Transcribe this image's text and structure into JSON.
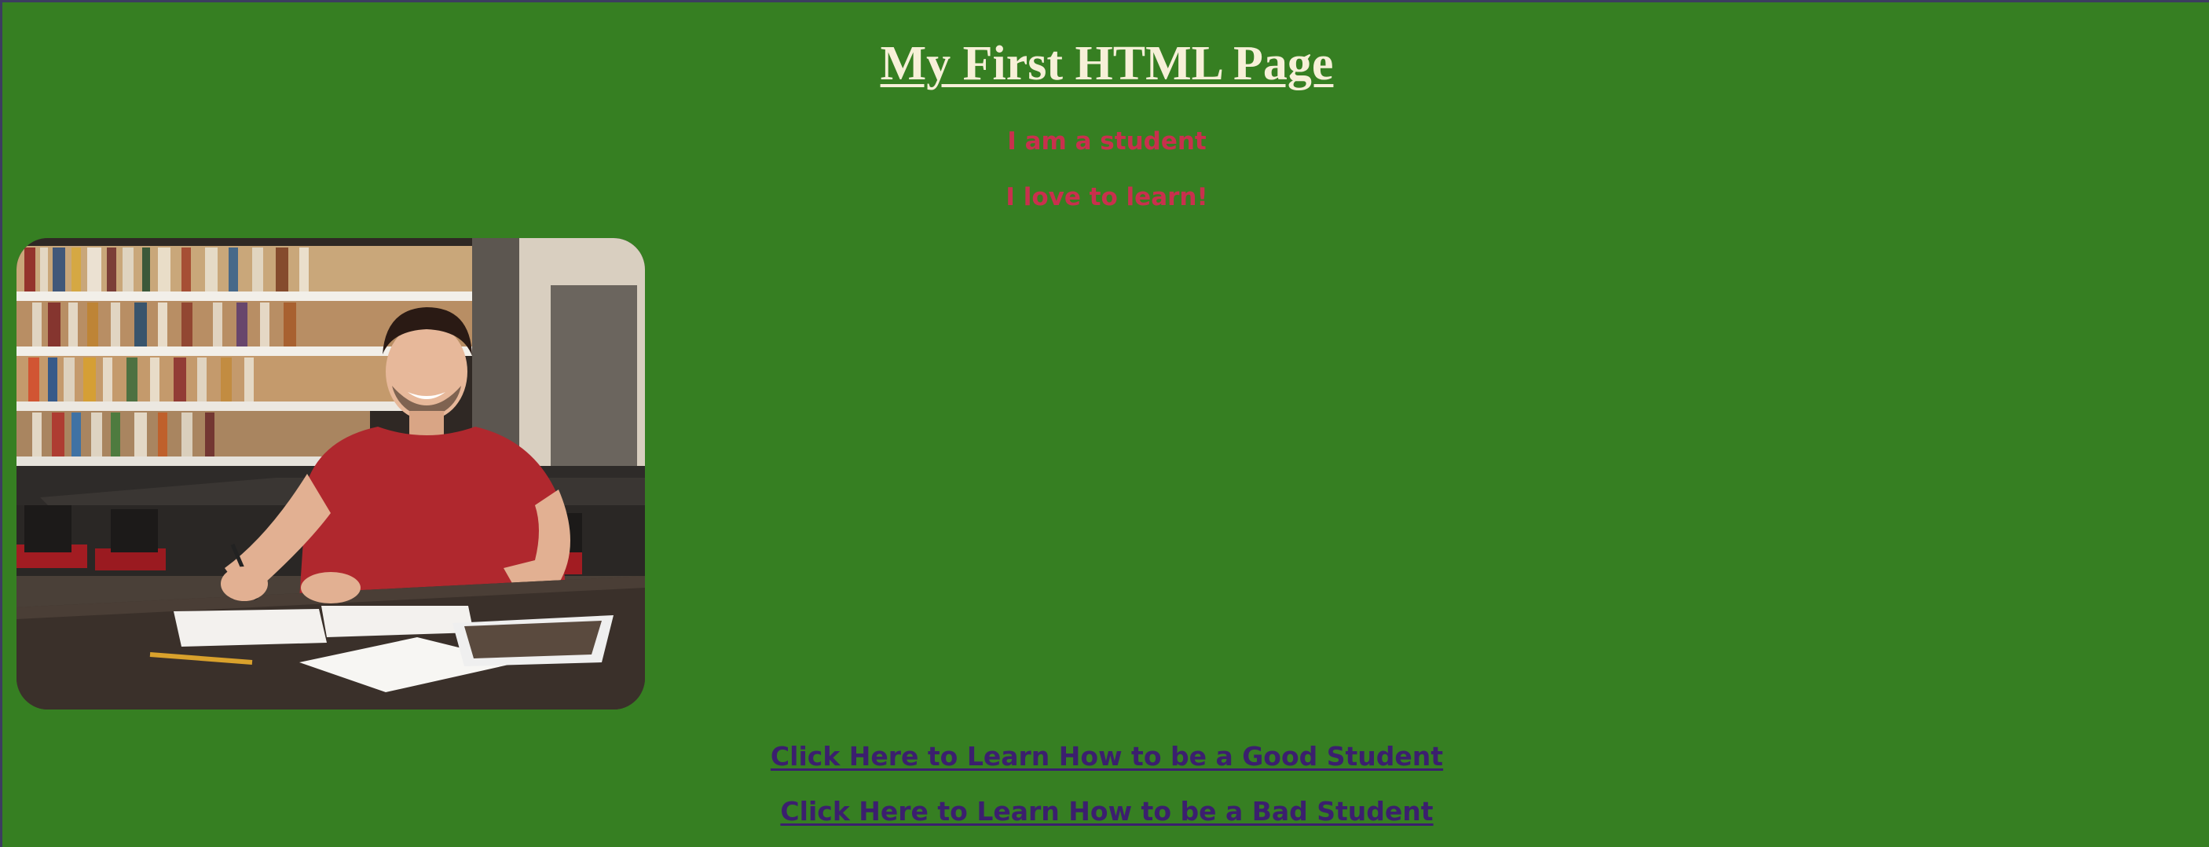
{
  "page": {
    "title": "My First HTML Page",
    "taglines": [
      "I am a student",
      "I love to learn!"
    ]
  },
  "image": {
    "alt": "student-studying-in-library"
  },
  "links": [
    {
      "label": "Click Here to Learn How to be a Good Student"
    },
    {
      "label": "Click Here to Learn How to be a Bad Student"
    }
  ],
  "colors": {
    "background": "#367f22",
    "title": "#f7f0d8",
    "tagline": "#c9304d",
    "link": "#3b1f6e"
  }
}
